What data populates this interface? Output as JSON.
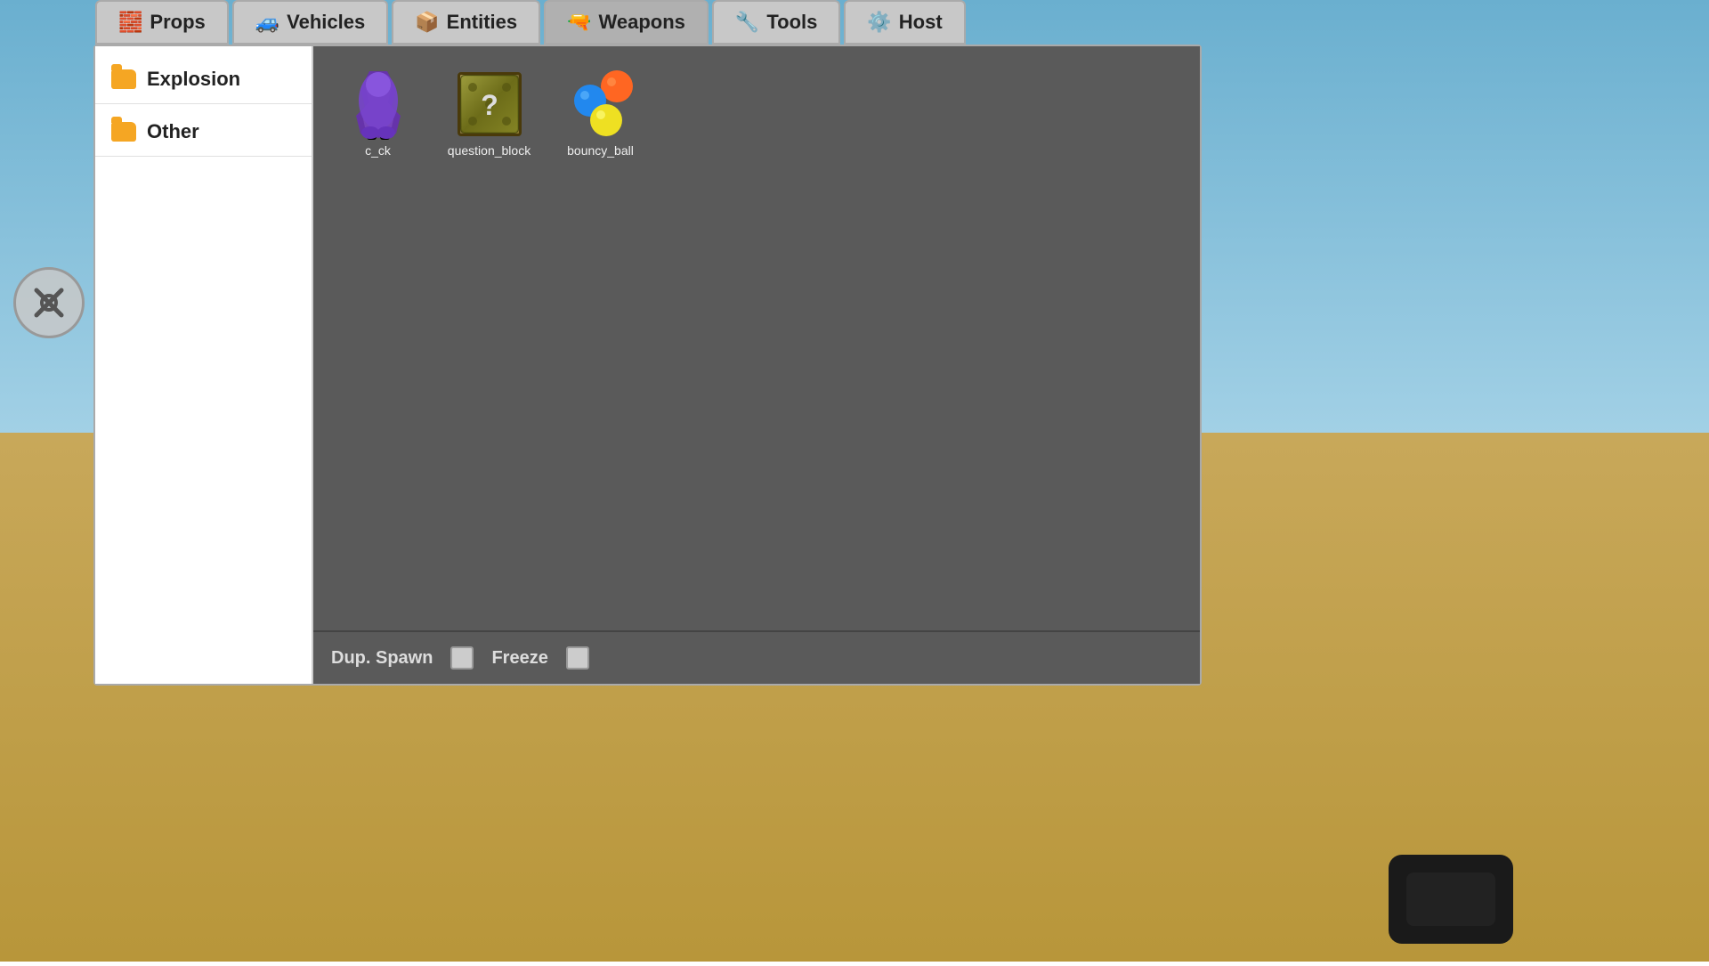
{
  "tabs": [
    {
      "id": "props",
      "label": "Props",
      "icon": "🧱",
      "active": false
    },
    {
      "id": "vehicles",
      "label": "Vehicles",
      "icon": "🚙",
      "active": false
    },
    {
      "id": "entities",
      "label": "Entities",
      "icon": "📦",
      "active": false
    },
    {
      "id": "weapons",
      "label": "Weapons",
      "icon": "🔫",
      "active": true
    },
    {
      "id": "tools",
      "label": "Tools",
      "icon": "🔧",
      "active": false
    },
    {
      "id": "host",
      "label": "Host",
      "icon": "⚙️",
      "active": false
    }
  ],
  "sidebar": {
    "items": [
      {
        "id": "explosion",
        "label": "Explosion"
      },
      {
        "id": "other",
        "label": "Other"
      }
    ]
  },
  "active_category": "Other",
  "grid_items": [
    {
      "id": "c_ck",
      "label": "c_ck"
    },
    {
      "id": "question_block",
      "label": "question_block"
    },
    {
      "id": "bouncy_ball",
      "label": "bouncy_ball"
    }
  ],
  "bottom_bar": {
    "dup_spawn_label": "Dup. Spawn",
    "freeze_label": "Freeze"
  },
  "colors": {
    "accent_orange": "#F5A623",
    "bg_panel": "#5a5a5a",
    "sidebar_bg": "#ffffff",
    "tab_bg": "#c8c8c8"
  }
}
